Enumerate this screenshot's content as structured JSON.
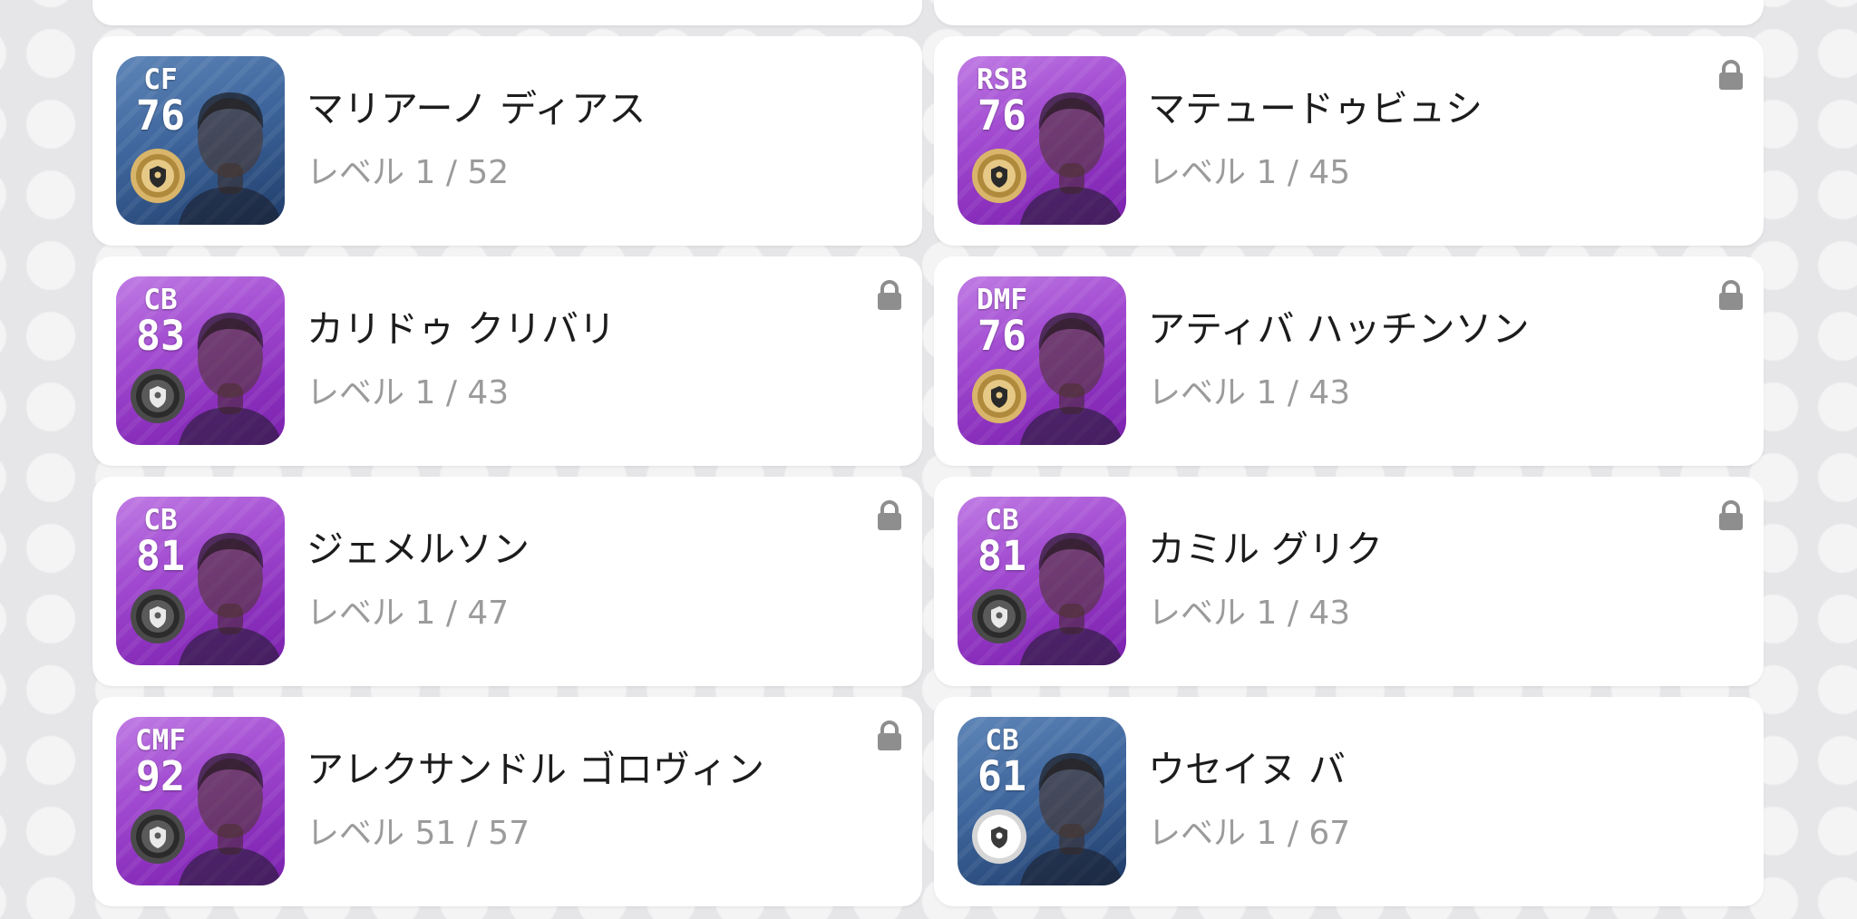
{
  "icons": {
    "lock": "lock-icon",
    "medal_gold": "gold-medal-icon",
    "medal_black": "black-medal-icon",
    "medal_white": "white-medal-icon"
  },
  "colors": {
    "background": "#e6e6e9",
    "card": "#ffffff",
    "name_text": "#1c1c1c",
    "level_text": "#9b9b9b",
    "lock": "#8e8e8e",
    "featured_card": "#a24bd1",
    "standard_card": "#3e669d"
  },
  "players": [
    {
      "position": "CF",
      "rating": "76",
      "name": "マリアーノ ディアス",
      "level_label": "レベル",
      "level": "1 / 52",
      "card_type": "standard",
      "medal": "gold",
      "locked": false
    },
    {
      "position": "RSB",
      "rating": "76",
      "name": "マテュードゥビュシ",
      "level_label": "レベル",
      "level": "1 / 45",
      "card_type": "featured",
      "medal": "gold",
      "locked": true
    },
    {
      "position": "CB",
      "rating": "83",
      "name": "カリドゥ クリバリ",
      "level_label": "レベル",
      "level": "1 / 43",
      "card_type": "featured",
      "medal": "black",
      "locked": true
    },
    {
      "position": "DMF",
      "rating": "76",
      "name": "アティバ ハッチンソン",
      "level_label": "レベル",
      "level": "1 / 43",
      "card_type": "featured",
      "medal": "gold",
      "locked": true
    },
    {
      "position": "CB",
      "rating": "81",
      "name": "ジェメルソン",
      "level_label": "レベル",
      "level": "1 / 47",
      "card_type": "featured",
      "medal": "black",
      "locked": true
    },
    {
      "position": "CB",
      "rating": "81",
      "name": "カミル グリク",
      "level_label": "レベル",
      "level": "1 / 43",
      "card_type": "featured",
      "medal": "black",
      "locked": true
    },
    {
      "position": "CMF",
      "rating": "92",
      "name": "アレクサンドル ゴロヴィン",
      "level_label": "レベル",
      "level": "51 / 57",
      "card_type": "featured",
      "medal": "black",
      "locked": true
    },
    {
      "position": "CB",
      "rating": "61",
      "name": "ウセイヌ バ",
      "level_label": "レベル",
      "level": "1 / 67",
      "card_type": "standard",
      "medal": "white",
      "locked": false
    }
  ]
}
